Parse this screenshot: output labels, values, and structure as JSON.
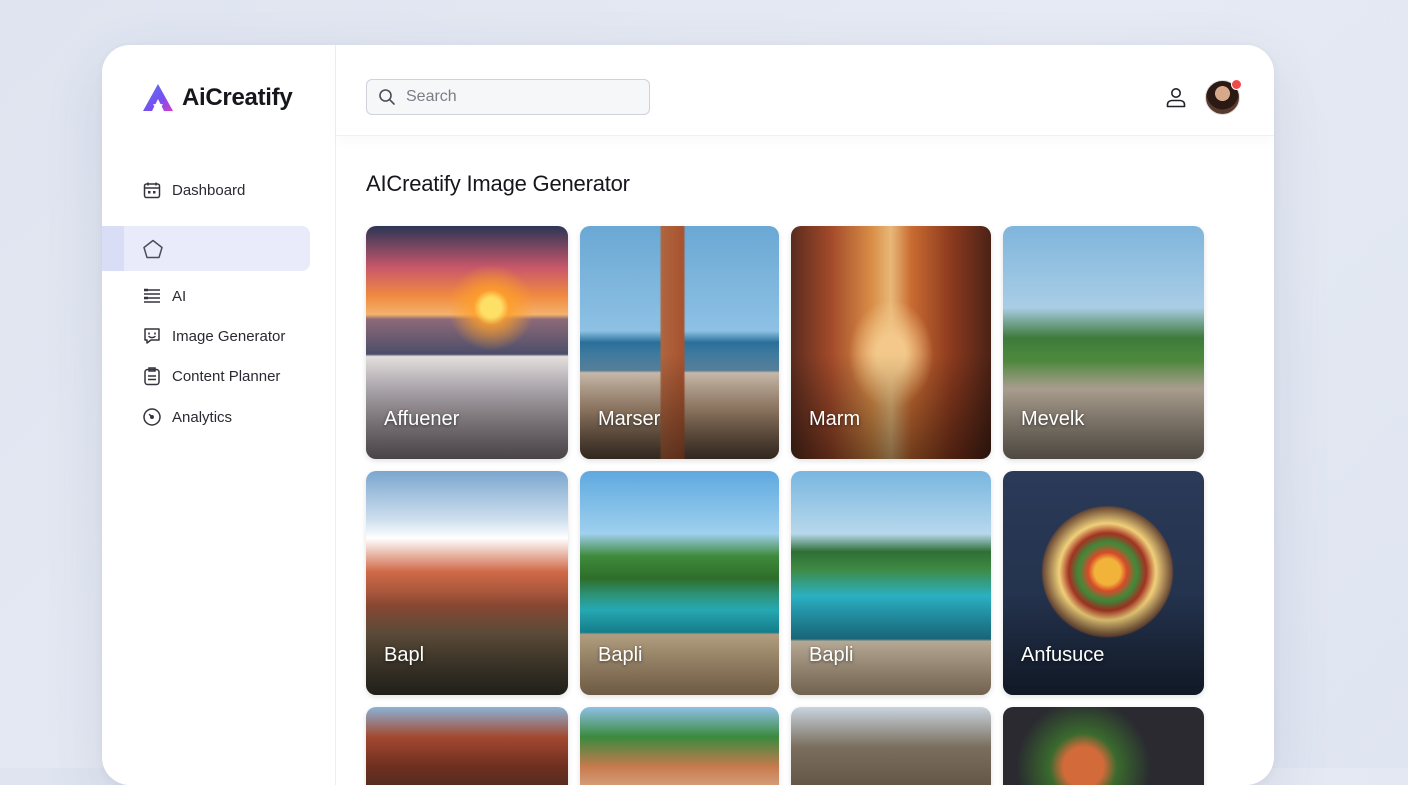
{
  "app": {
    "name": "AiCreatify"
  },
  "search": {
    "placeholder": "Search"
  },
  "sidebar": {
    "items": [
      {
        "label": "Dashboard",
        "icon": "calendar-grid-icon"
      },
      {
        "label": "",
        "icon": "home-icon",
        "active": true
      },
      {
        "label": "AI",
        "icon": "list-lines-icon"
      },
      {
        "label": "Image Generator",
        "icon": "chat-face-icon"
      },
      {
        "label": "Content Planner",
        "icon": "clipboard-icon"
      },
      {
        "label": "Analytics",
        "icon": "gauge-icon"
      }
    ]
  },
  "main": {
    "title": "AICreatify Image Generator",
    "cards": [
      {
        "label": "Affuener"
      },
      {
        "label": "Marser"
      },
      {
        "label": "Marm"
      },
      {
        "label": "Mevelk"
      },
      {
        "label": "Bapl"
      },
      {
        "label": "Bapli"
      },
      {
        "label": "Bapli"
      },
      {
        "label": "Anfusuce"
      },
      {
        "label": ""
      },
      {
        "label": ""
      },
      {
        "label": ""
      },
      {
        "label": ""
      }
    ]
  },
  "colors": {
    "accent": "#e9ebfb",
    "notification": "#ef4a4a"
  }
}
